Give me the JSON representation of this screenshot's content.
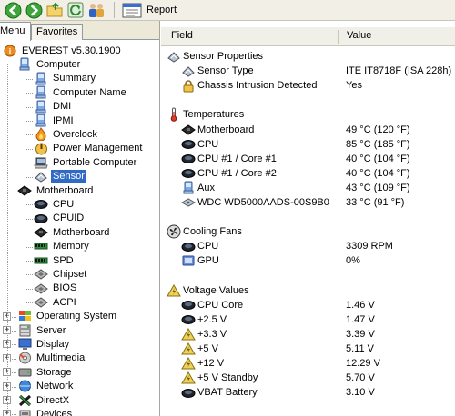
{
  "toolbar": {
    "report_label": "Report"
  },
  "left_panel": {
    "tabs": [
      {
        "label": "Menu",
        "active": true
      },
      {
        "label": "Favorites",
        "active": false
      }
    ],
    "tree": [
      {
        "label": "EVEREST v5.30.1900",
        "icon": "everest-icon",
        "level": 0
      },
      {
        "label": "Computer",
        "icon": "computer-icon",
        "level": 1
      },
      {
        "label": "Summary",
        "icon": "computer-icon",
        "level": 2
      },
      {
        "label": "Computer Name",
        "icon": "computer-icon",
        "level": 2
      },
      {
        "label": "DMI",
        "icon": "computer-icon",
        "level": 2
      },
      {
        "label": "IPMI",
        "icon": "computer-icon",
        "level": 2
      },
      {
        "label": "Overclock",
        "icon": "flame-icon",
        "level": 2
      },
      {
        "label": "Power Management",
        "icon": "power-icon",
        "level": 2
      },
      {
        "label": "Portable Computer",
        "icon": "laptop-icon",
        "level": 2
      },
      {
        "label": "Sensor",
        "icon": "sensor-icon",
        "level": 2,
        "selected": true
      },
      {
        "label": "Motherboard",
        "icon": "motherboard-icon",
        "level": 1
      },
      {
        "label": "CPU",
        "icon": "chip-icon",
        "level": 2
      },
      {
        "label": "CPUID",
        "icon": "chip-icon",
        "level": 2
      },
      {
        "label": "Motherboard",
        "icon": "motherboard-icon",
        "level": 2
      },
      {
        "label": "Memory",
        "icon": "memory-icon",
        "level": 2
      },
      {
        "label": "SPD",
        "icon": "memory-icon",
        "level": 2
      },
      {
        "label": "Chipset",
        "icon": "chipset-icon",
        "level": 2
      },
      {
        "label": "BIOS",
        "icon": "chipset-icon",
        "level": 2
      },
      {
        "label": "ACPI",
        "icon": "chipset-icon",
        "level": 2
      },
      {
        "label": "Operating System",
        "icon": "windows-icon",
        "level": 1
      },
      {
        "label": "Server",
        "icon": "server-icon",
        "level": 1
      },
      {
        "label": "Display",
        "icon": "display-icon",
        "level": 1
      },
      {
        "label": "Multimedia",
        "icon": "multimedia-icon",
        "level": 1
      },
      {
        "label": "Storage",
        "icon": "storage-icon",
        "level": 1
      },
      {
        "label": "Network",
        "icon": "network-icon",
        "level": 1
      },
      {
        "label": "DirectX",
        "icon": "directx-icon",
        "level": 1
      },
      {
        "label": "Devices",
        "icon": "devices-icon",
        "level": 1
      }
    ]
  },
  "table": {
    "col_field": "Field",
    "col_value": "Value",
    "rows": [
      {
        "type": "section",
        "field": "Sensor Properties",
        "icon": "sensor-icon"
      },
      {
        "type": "item",
        "field": "Sensor Type",
        "value": "ITE IT8718F  (ISA 228h)",
        "icon": "sensor-icon"
      },
      {
        "type": "item",
        "field": "Chassis Intrusion Detected",
        "value": "Yes",
        "icon": "lock-icon"
      },
      {
        "type": "blank"
      },
      {
        "type": "section",
        "field": "Temperatures",
        "icon": "thermometer-icon"
      },
      {
        "type": "item",
        "field": "Motherboard",
        "value": "49 °C  (120 °F)",
        "icon": "motherboard-icon"
      },
      {
        "type": "item",
        "field": "CPU",
        "value": "85 °C  (185 °F)",
        "icon": "chip-icon"
      },
      {
        "type": "item",
        "field": "CPU #1 / Core #1",
        "value": "40 °C  (104 °F)",
        "icon": "chip-icon"
      },
      {
        "type": "item",
        "field": "CPU #1 / Core #2",
        "value": "40 °C  (104 °F)",
        "icon": "chip-icon"
      },
      {
        "type": "item",
        "field": "Aux",
        "value": "43 °C  (109 °F)",
        "icon": "computer-icon"
      },
      {
        "type": "item",
        "field": "WDC WD5000AADS-00S9B0",
        "value": "33 °C  (91 °F)",
        "icon": "harddisk-icon"
      },
      {
        "type": "blank"
      },
      {
        "type": "section",
        "field": "Cooling Fans",
        "icon": "fan-icon"
      },
      {
        "type": "item",
        "field": "CPU",
        "value": "3309 RPM",
        "icon": "chip-icon"
      },
      {
        "type": "item",
        "field": "GPU",
        "value": "0%",
        "icon": "gpu-icon"
      },
      {
        "type": "blank"
      },
      {
        "type": "section",
        "field": "Voltage Values",
        "icon": "voltage-icon"
      },
      {
        "type": "item",
        "field": "CPU Core",
        "value": "1.46 V",
        "icon": "chip-icon"
      },
      {
        "type": "item",
        "field": "+2.5 V",
        "value": "1.47 V",
        "icon": "chip-icon"
      },
      {
        "type": "item",
        "field": "+3.3 V",
        "value": "3.39 V",
        "icon": "voltage-icon"
      },
      {
        "type": "item",
        "field": "+5 V",
        "value": "5.11 V",
        "icon": "voltage-icon"
      },
      {
        "type": "item",
        "field": "+12 V",
        "value": "12.29 V",
        "icon": "voltage-icon"
      },
      {
        "type": "item",
        "field": "+5 V Standby",
        "value": "5.70 V",
        "icon": "voltage-icon"
      },
      {
        "type": "item",
        "field": "VBAT Battery",
        "value": "3.10 V",
        "icon": "chip-icon"
      }
    ]
  },
  "colors": {
    "selection": "#316ac5",
    "toolbar_bg": "#f1efe6",
    "header_bg": "#f0efe8"
  }
}
